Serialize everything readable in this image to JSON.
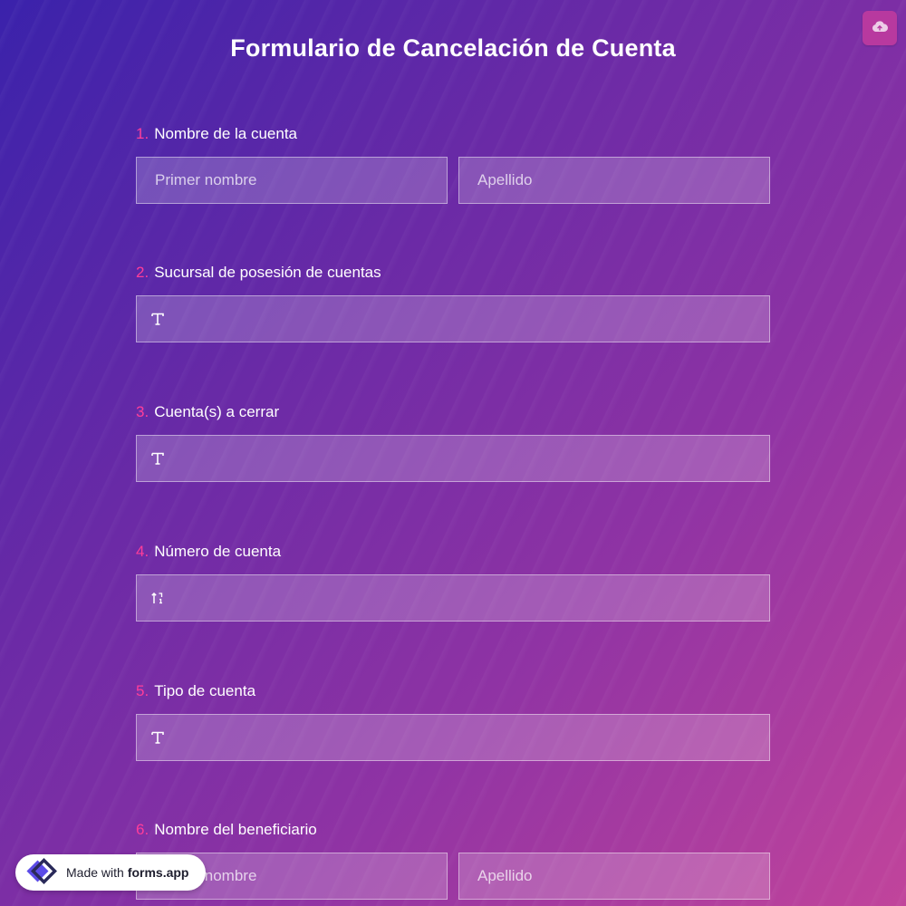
{
  "title": "Formulario de Cancelación de Cuenta",
  "upload_icon": "cloud-upload-icon",
  "questions": [
    {
      "number": "1.",
      "label": "Nombre de la cuenta",
      "first_placeholder": "Primer nombre",
      "last_placeholder": "Apellido"
    },
    {
      "number": "2.",
      "label": "Sucursal de posesión de cuentas",
      "icon": "text-icon"
    },
    {
      "number": "3.",
      "label": "Cuenta(s) a cerrar",
      "icon": "text-icon"
    },
    {
      "number": "4.",
      "label": "Número de cuenta",
      "icon": "number-icon"
    },
    {
      "number": "5.",
      "label": "Tipo de cuenta",
      "icon": "text-icon"
    },
    {
      "number": "6.",
      "label": "Nombre del beneficiario",
      "first_placeholder": "Primer nombre",
      "last_placeholder": "Apellido"
    }
  ],
  "badge": {
    "prefix": "Made with",
    "brand": "forms.app"
  },
  "colors": {
    "accent_number": "#ff3d9a",
    "cloud_button": "#b8399f",
    "background_start": "#3a22ab",
    "background_end": "#c1449b"
  }
}
